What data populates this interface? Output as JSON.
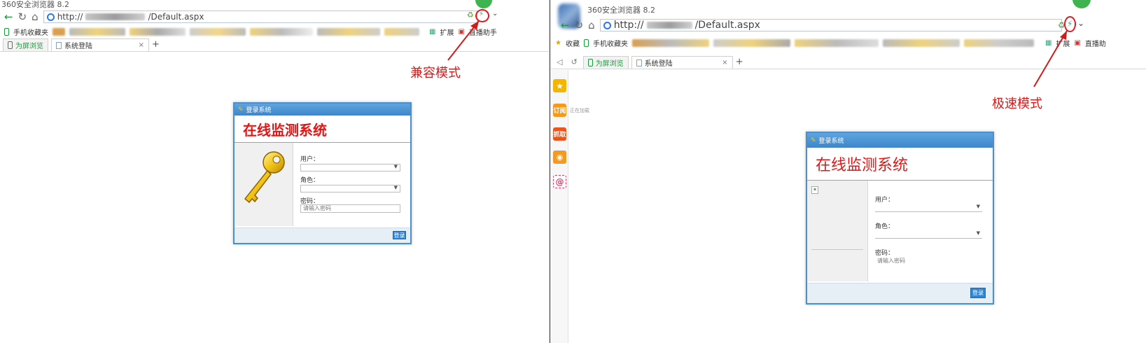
{
  "left": {
    "window_title": "360安全浏览器 8.2",
    "url_visible": "http://",
    "url_tail": "/Default.aspx",
    "bookmarks": {
      "mobile": "手机收藏夹",
      "extensions": "扩展",
      "live": "直播助手"
    },
    "tabs": [
      {
        "label": "为屏浏览"
      },
      {
        "label": "系统登陆"
      }
    ],
    "annotation": "兼容模式",
    "dialog": {
      "header": "登录系统",
      "title": "在线监测系统",
      "fields": [
        {
          "label": "用户："
        },
        {
          "label": "角色："
        },
        {
          "label": "密码："
        }
      ],
      "password_placeholder": "请输入密码",
      "login_button": "登录"
    }
  },
  "right": {
    "window_title": "360安全浏览器 8.2",
    "url_visible": "http://",
    "url_tail": "/Default.aspx",
    "bookmarks": {
      "favorites": "收藏",
      "mobile": "手机收藏夹",
      "extensions": "扩展",
      "live": "直播助"
    },
    "tabs": [
      {
        "label": "为屏浏览"
      },
      {
        "label": "系统登陆"
      }
    ],
    "side_note": "正在加载",
    "annotation": "极速模式",
    "sidebar": {
      "subscribe": "订阅",
      "fetch": "抓取"
    },
    "dialog": {
      "header": "登录系统",
      "title": "在线监测系统",
      "fields": [
        {
          "label": "用户："
        },
        {
          "label": "角色："
        },
        {
          "label": "密码："
        }
      ],
      "password_placeholder": "请输入密码",
      "login_button": "登录"
    }
  },
  "colors": {
    "annotation": "#d31a1a",
    "dialog_header": "#3d86c9",
    "title_red": "#e11717",
    "browser_green": "#1a9a3a"
  }
}
